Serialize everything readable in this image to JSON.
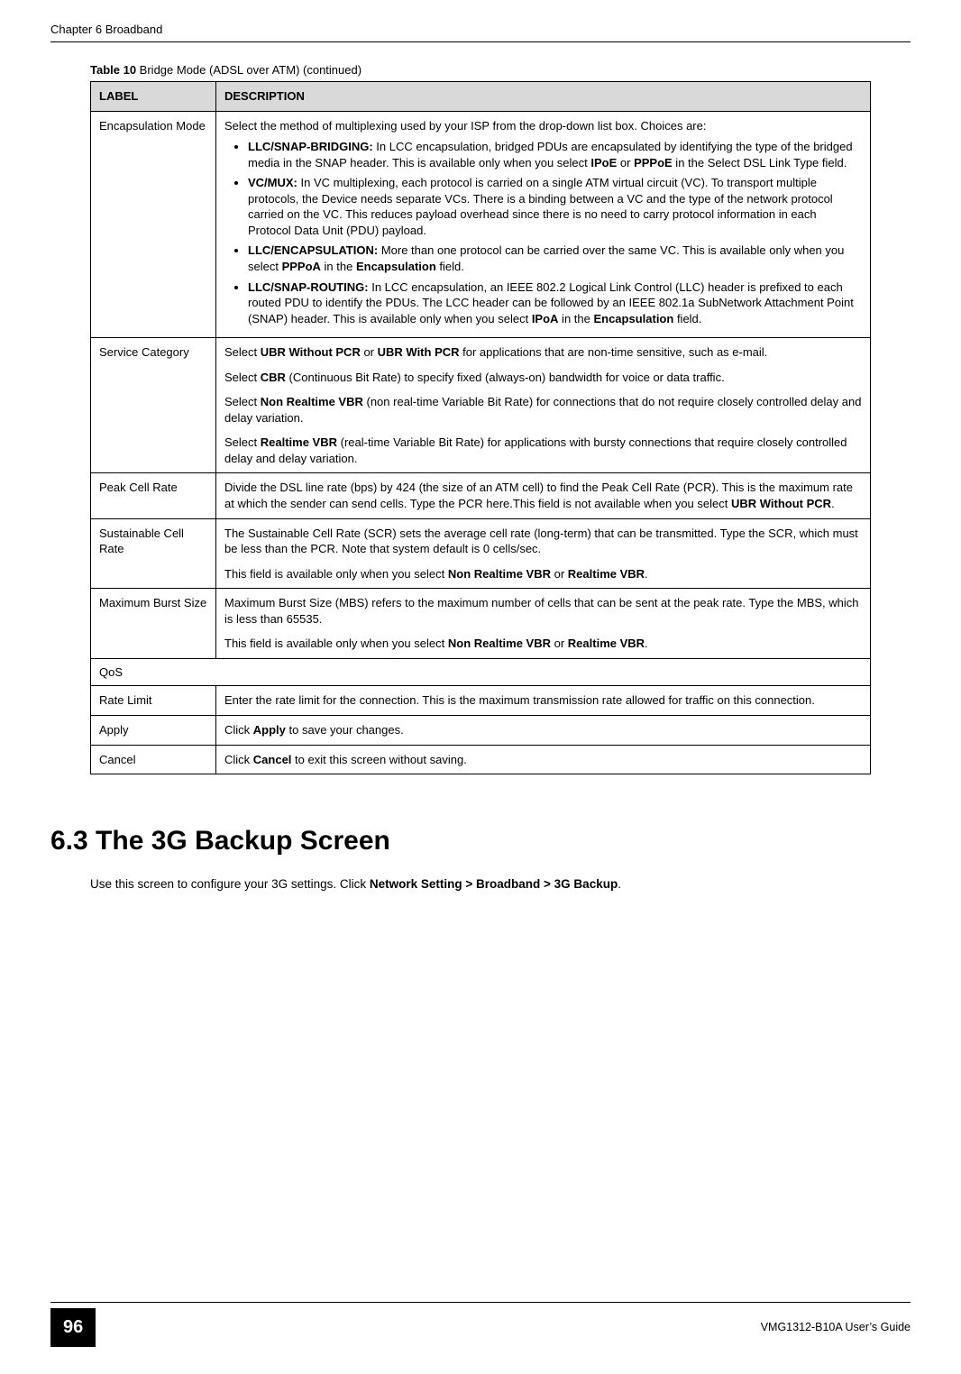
{
  "header": {
    "chapter": "Chapter 6 Broadband"
  },
  "table": {
    "caption_prefix": "Table 10",
    "caption_rest": "   Bridge Mode (ADSL over ATM) (continued)",
    "col1": "LABEL",
    "col2": "DESCRIPTION",
    "rows": {
      "encap_mode": {
        "label": "Encapsulation Mode",
        "intro": "Select the method of multiplexing used by your ISP from the drop-down list box. Choices are:",
        "items": {
          "llc_snap_bridging": {
            "name": "LLC/SNAP-BRIDGING:",
            "text": " In LCC encapsulation, bridged PDUs are encapsulated by identifying the type of the bridged media in the SNAP header. This is available only when you select ",
            "bold1": "IPoE",
            "mid": " or ",
            "bold2": "PPPoE",
            "tail": " in the Select DSL Link Type field."
          },
          "vcmux": {
            "name": "VC/MUX:",
            "text": " In VC multiplexing, each protocol is carried on a single ATM virtual circuit (VC). To transport multiple protocols, the Device needs separate VCs. There is a binding between a VC and the type of the network protocol carried on the VC. This reduces payload overhead since there is no need to carry protocol information in each Protocol Data Unit (PDU) payload."
          },
          "llc_encaps": {
            "name": "LLC/ENCAPSULATION:",
            "text": " More than one protocol can be carried over the same VC. This is available only when you select ",
            "bold1": "PPPoA",
            "mid": " in the ",
            "bold2": "Encapsulation",
            "tail": " field."
          },
          "llc_snap_routing": {
            "name": "LLC/SNAP-ROUTING:",
            "text": " In LCC encapsulation, an IEEE 802.2 Logical Link Control (LLC) header is prefixed to each routed PDU to identify the PDUs. The LCC header can be followed by an IEEE 802.1a SubNetwork Attachment Point (SNAP) header. This is available only when you select ",
            "bold1": "IPoA",
            "mid": " in the ",
            "bold2": "Encapsulation",
            "tail": " field."
          }
        }
      },
      "service_category": {
        "label": "Service Category",
        "p1a": "Select ",
        "p1b1": "UBR Without PCR",
        "p1mid": " or ",
        "p1b2": "UBR With PCR",
        "p1tail": " for applications that are non-time sensitive, such as e-mail.",
        "p2a": "Select ",
        "p2b": "CBR",
        "p2tail": " (Continuous Bit Rate) to specify fixed (always-on) bandwidth for voice or data traffic.",
        "p3a": "Select ",
        "p3b": "Non Realtime VBR",
        "p3tail": " (non real-time Variable Bit Rate) for connections that do not require closely controlled delay and delay variation.",
        "p4a": "Select ",
        "p4b": "Realtime VBR",
        "p4tail": " (real-time Variable Bit Rate) for applications with bursty connections that require closely controlled delay and delay variation."
      },
      "peak_cell_rate": {
        "label": "Peak Cell Rate",
        "desc_a": "Divide the DSL line rate (bps) by 424 (the size of an ATM cell) to find the Peak Cell Rate (PCR). This is the maximum rate at which the sender can send cells. Type the PCR here.This field is not available when you select ",
        "desc_b": "UBR Without PCR",
        "desc_c": "."
      },
      "sustainable_cell_rate": {
        "label": "Sustainable Cell Rate",
        "p1": "The Sustainable Cell Rate (SCR) sets the average cell rate (long-term) that can be transmitted. Type the SCR, which must be less than the PCR. Note that system default is 0 cells/sec.",
        "p2a": "This field is available only when you select ",
        "p2b1": "Non Realtime VBR",
        "p2mid": " or ",
        "p2b2": "Realtime VBR",
        "p2tail": "."
      },
      "max_burst_size": {
        "label": "Maximum Burst Size",
        "p1": "Maximum Burst Size (MBS) refers to the maximum number of cells that can be sent at the peak rate. Type the MBS, which is less than 65535.",
        "p2a": "This field is available only when you select ",
        "p2b1": "Non Realtime VBR",
        "p2mid": " or ",
        "p2b2": "Realtime VBR",
        "p2tail": "."
      },
      "qos": {
        "label": "QoS"
      },
      "rate_limit": {
        "label": "Rate Limit",
        "desc": "Enter the rate limit for the connection. This is the maximum transmission rate allowed for traffic on this connection."
      },
      "apply": {
        "label": "Apply",
        "desc_a": "Click ",
        "desc_b": "Apply",
        "desc_c": " to save your changes."
      },
      "cancel": {
        "label": "Cancel",
        "desc_a": "Click ",
        "desc_b": "Cancel",
        "desc_c": " to exit this screen without saving."
      }
    }
  },
  "section": {
    "title": "6.3  The 3G Backup Screen",
    "body_a": "Use this screen to configure your 3G settings. Click ",
    "body_b": "Network Setting > Broadband > 3G Backup",
    "body_c": "."
  },
  "footer": {
    "page": "96",
    "guide": "VMG1312-B10A User’s Guide"
  }
}
